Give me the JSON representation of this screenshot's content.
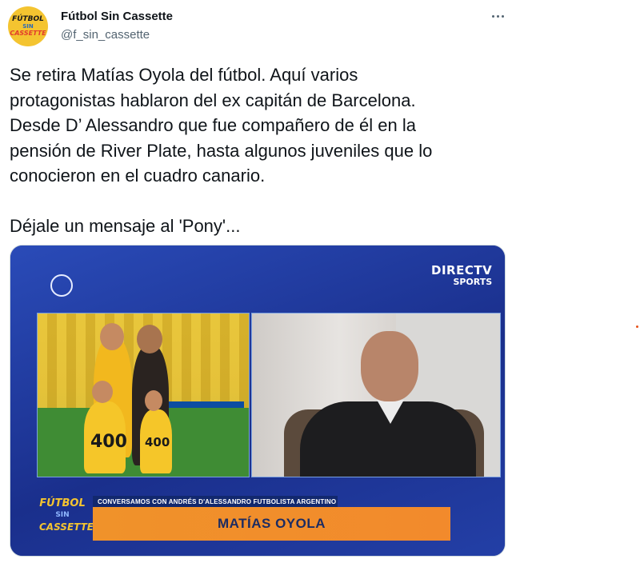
{
  "author": {
    "avatar_text": {
      "line1": "FÚTBOL",
      "line2": "SIN",
      "line3": "CASSETTE"
    },
    "name": "Fútbol Sin Cassette",
    "handle": "@f_sin_cassette"
  },
  "more_icon": "more-horizontal-icon",
  "tweet": {
    "text": "Se retira Matías Oyola del fútbol. Aquí varios\nprotagonistas hablaron del ex capitán de Barcelona.\nDesde D’ Alessandro que fue compañero de él en la\npensión de River Plate, hasta algunos juveniles que lo\nconocieron en el cuadro canario.\n\nDéjale un mensaje al 'Pony'..."
  },
  "media": {
    "broadcaster": {
      "line1": "DIRECTV",
      "line2": "SPORTS"
    },
    "shirt_number_1": "400",
    "shirt_number_2": "400",
    "overlay_logo": {
      "line1": "FÚTBOL",
      "line2": "SIN",
      "line3": "CASSETTE"
    },
    "lower_third_small": "CONVERSAMOS CON ANDRÉS D'ALESSANDRO FUTBOLISTA ARGENTINO",
    "lower_third_name": "MATÍAS OYOLA"
  },
  "colors": {
    "media_blue": "#1e3b9a",
    "lower_third_orange": "#f0922a",
    "accent_yellow": "#f4c430"
  }
}
